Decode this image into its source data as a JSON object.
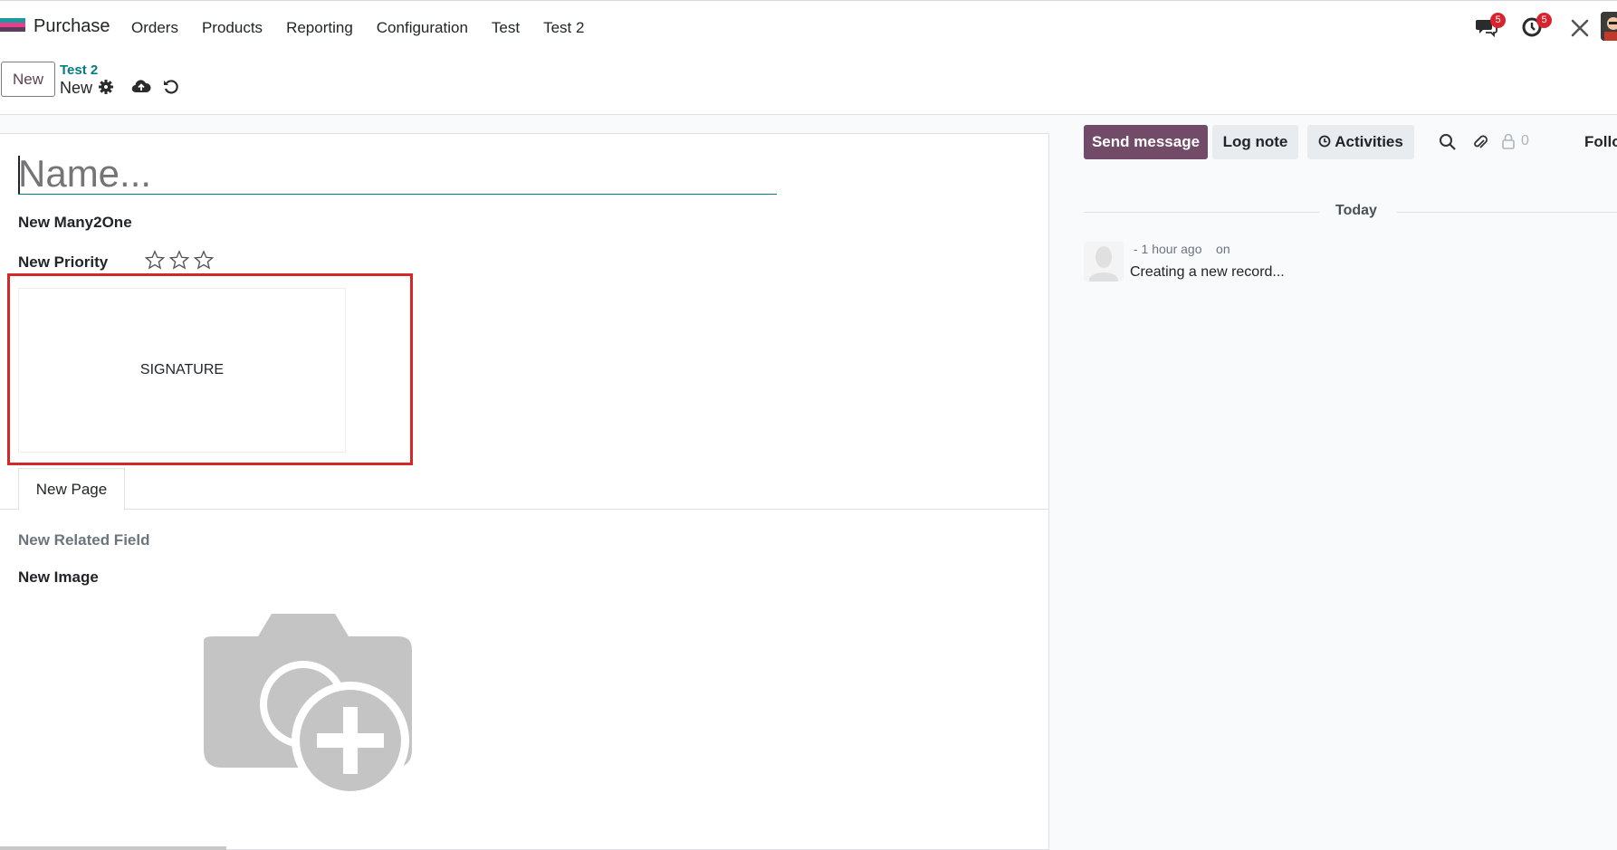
{
  "app": {
    "name": "Purchase",
    "logo_colors": [
      "#e83e8c",
      "#1a9ba1",
      "#5b3c5e"
    ]
  },
  "menu": [
    "Orders",
    "Products",
    "Reporting",
    "Configuration",
    "Test",
    "Test 2"
  ],
  "systray": {
    "messages_icon": "chat-bubbles-icon",
    "messages_count": "5",
    "activities_icon": "clock-icon",
    "activities_count": "5",
    "debug_icon": "tools-icon"
  },
  "control_panel": {
    "new_button": "New",
    "breadcrumb_parent": "Test 2",
    "breadcrumb_current": "New",
    "icons": [
      "gear-icon",
      "cloud-upload-icon",
      "discard-icon"
    ]
  },
  "form": {
    "name_placeholder": "Name...",
    "many2one_label": "New Many2One",
    "priority_label": "New Priority",
    "priority_stars": 3,
    "priority_value": 0,
    "signature_placeholder": "SIGNATURE",
    "tabs": [
      "New Page"
    ],
    "related_field_label": "New Related Field",
    "image_label": "New Image"
  },
  "chatter": {
    "send_message": "Send message",
    "log_note": "Log note",
    "activities": "Activities",
    "follower_count": "0",
    "follow_label": "Follo",
    "date_separator": "Today",
    "messages": [
      {
        "meta": "- 1 hour ago    on",
        "body": "Creating a new record..."
      }
    ]
  },
  "colors": {
    "brand": "#714b67",
    "accent": "#017e84",
    "highlight": "#d62728",
    "badge": "#d9232d"
  }
}
